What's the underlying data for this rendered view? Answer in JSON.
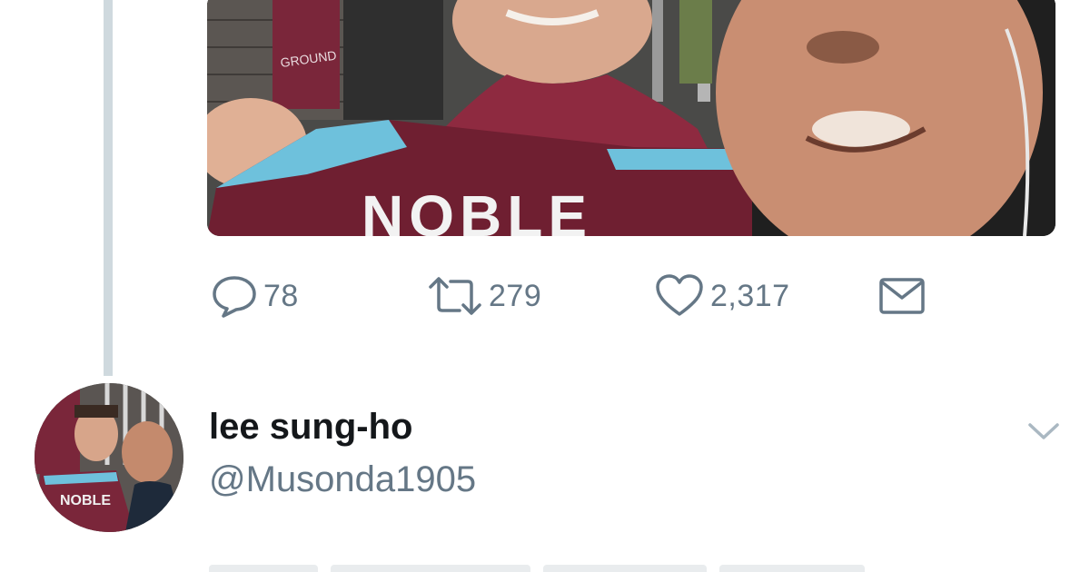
{
  "tweet": {
    "photo": {
      "jersey_text": "NOBLE",
      "sign_text": "GROUND"
    },
    "actions": {
      "reply_count": "78",
      "retweet_count": "279",
      "like_count": "2,317"
    }
  },
  "reply_tweet": {
    "display_name": "lee sung-ho",
    "handle": "@Musonda1905",
    "avatar_jersey_text": "NOBLE"
  },
  "icons": {
    "reply": "reply-icon",
    "retweet": "retweet-icon",
    "like": "heart-icon",
    "direct_message": "envelope-icon",
    "more": "chevron-down-icon"
  },
  "colors": {
    "icon_gray": "#657786",
    "text_primary": "#14171a",
    "thread_line": "#cfd9de",
    "claret": "#7a263a",
    "sky_blue": "#1bb1e7"
  }
}
